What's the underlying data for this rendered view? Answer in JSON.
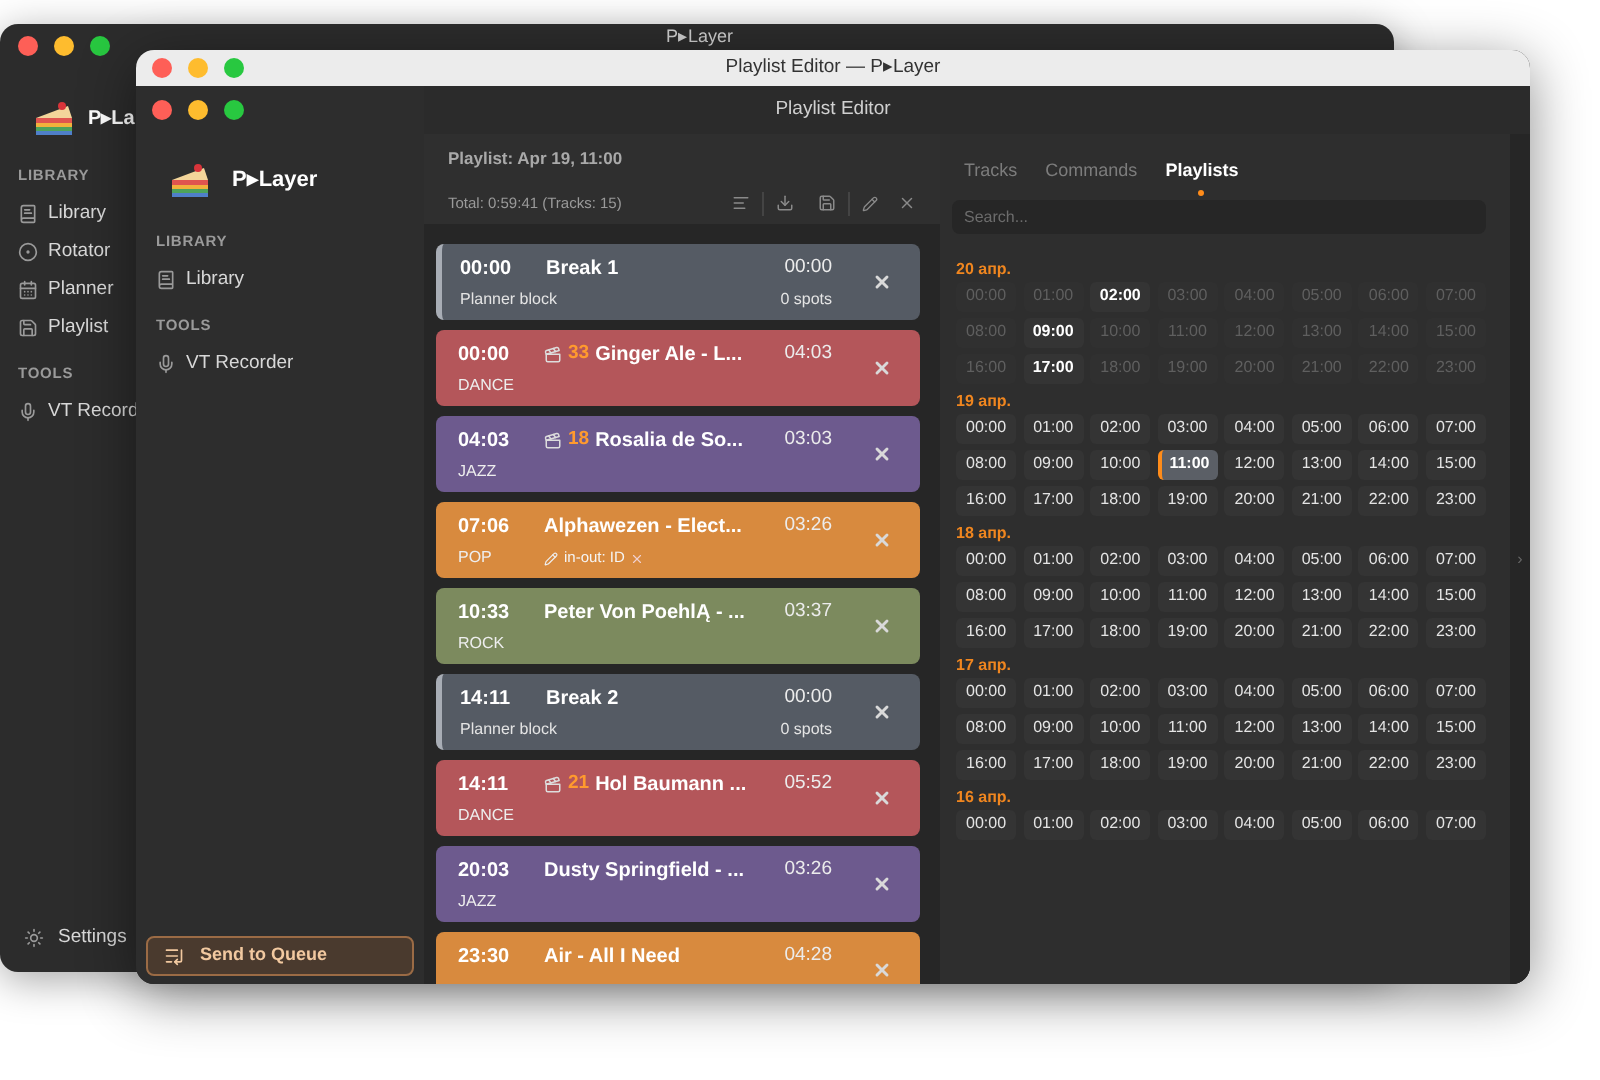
{
  "back_window": {
    "title": "P▸Layer",
    "app_name": "P▸La",
    "sections": [
      {
        "heading": "LIBRARY",
        "items": [
          {
            "label": "Library"
          },
          {
            "label": "Rotator"
          },
          {
            "label": "Planner"
          },
          {
            "label": "Playlist"
          }
        ]
      },
      {
        "heading": "TOOLS",
        "items": [
          {
            "label": "VT Record"
          }
        ]
      }
    ],
    "settings": "Settings"
  },
  "window": {
    "title": "Playlist Editor — P▸Layer",
    "inner_title": "Playlist Editor",
    "app_name": "P▸Layer",
    "sections": [
      {
        "heading": "LIBRARY",
        "items": [
          {
            "label": "Library"
          }
        ]
      },
      {
        "heading": "TOOLS",
        "items": [
          {
            "label": "VT Recorder"
          }
        ]
      }
    ],
    "send_button": "Send to Queue"
  },
  "playlist": {
    "title": "Playlist: Apr 19, 11:00",
    "total": "Total: 0:59:41 (Tracks: 15)",
    "items": [
      {
        "kind": "break",
        "start": "00:00",
        "title": "Break 1",
        "duration": "00:00",
        "subtitle": "Planner block",
        "spots": "0 spots",
        "color": "#555b64"
      },
      {
        "kind": "track",
        "start": "00:00",
        "badge": "33",
        "title": "Ginger Ale - L...",
        "duration": "04:03",
        "genre": "DANCE",
        "color": "#b4565a"
      },
      {
        "kind": "track",
        "start": "04:03",
        "badge": "18",
        "title": "Rosalia de So...",
        "duration": "03:03",
        "genre": "JAZZ",
        "color": "#6d5a8e"
      },
      {
        "kind": "track",
        "start": "07:06",
        "title": "Alphawezen - Elect...",
        "duration": "03:26",
        "genre": "POP",
        "note": "in-out: ID",
        "color": "#d88a3e"
      },
      {
        "kind": "track",
        "start": "10:33",
        "title": "Peter Von PoehlĄ - ...",
        "duration": "03:37",
        "genre": "ROCK",
        "color": "#7c8a5e"
      },
      {
        "kind": "break",
        "start": "14:11",
        "title": "Break 2",
        "duration": "00:00",
        "subtitle": "Planner block",
        "spots": "0 spots",
        "color": "#555b64"
      },
      {
        "kind": "track",
        "start": "14:11",
        "badge": "21",
        "title": "Hol Baumann ...",
        "duration": "05:52",
        "genre": "DANCE",
        "color": "#b4565a"
      },
      {
        "kind": "track",
        "start": "20:03",
        "title": "Dusty Springfield - ...",
        "duration": "03:26",
        "genre": "JAZZ",
        "color": "#6d5a8e"
      },
      {
        "kind": "track",
        "start": "23:30",
        "title": "Air - All I Need",
        "duration": "04:28",
        "color": "#d88a3e"
      }
    ]
  },
  "library": {
    "tabs": [
      {
        "label": "Tracks",
        "selected": false
      },
      {
        "label": "Commands",
        "selected": false
      },
      {
        "label": "Playlists",
        "selected": true
      }
    ],
    "search": {
      "placeholder": "Search..."
    },
    "days": [
      {
        "label": "20 апр.",
        "hours": [
          {
            "label": "00:00",
            "available": false,
            "selected": false
          },
          {
            "label": "01:00",
            "available": false,
            "selected": false
          },
          {
            "label": "02:00",
            "available": true,
            "selected": false
          },
          {
            "label": "03:00",
            "available": false,
            "selected": false
          },
          {
            "label": "04:00",
            "available": false,
            "selected": false
          },
          {
            "label": "05:00",
            "available": false,
            "selected": false
          },
          {
            "label": "06:00",
            "available": false,
            "selected": false
          },
          {
            "label": "07:00",
            "available": false,
            "selected": false
          },
          {
            "label": "08:00",
            "available": false,
            "selected": false
          },
          {
            "label": "09:00",
            "available": true,
            "selected": false
          },
          {
            "label": "10:00",
            "available": false,
            "selected": false
          },
          {
            "label": "11:00",
            "available": false,
            "selected": false
          },
          {
            "label": "12:00",
            "available": false,
            "selected": false
          },
          {
            "label": "13:00",
            "available": false,
            "selected": false
          },
          {
            "label": "14:00",
            "available": false,
            "selected": false
          },
          {
            "label": "15:00",
            "available": false,
            "selected": false
          },
          {
            "label": "16:00",
            "available": false,
            "selected": false
          },
          {
            "label": "17:00",
            "available": true,
            "selected": false
          },
          {
            "label": "18:00",
            "available": false,
            "selected": false
          },
          {
            "label": "19:00",
            "available": false,
            "selected": false
          },
          {
            "label": "20:00",
            "available": false,
            "selected": false
          },
          {
            "label": "21:00",
            "available": false,
            "selected": false
          },
          {
            "label": "22:00",
            "available": false,
            "selected": false
          },
          {
            "label": "23:00",
            "available": false,
            "selected": false
          }
        ]
      },
      {
        "label": "19 апр.",
        "hours": [
          {
            "label": "00:00",
            "available": true,
            "selected": false
          },
          {
            "label": "01:00",
            "available": true,
            "selected": false
          },
          {
            "label": "02:00",
            "available": true,
            "selected": false
          },
          {
            "label": "03:00",
            "available": true,
            "selected": false
          },
          {
            "label": "04:00",
            "available": true,
            "selected": false
          },
          {
            "label": "05:00",
            "available": true,
            "selected": false
          },
          {
            "label": "06:00",
            "available": true,
            "selected": false
          },
          {
            "label": "07:00",
            "available": true,
            "selected": false
          },
          {
            "label": "08:00",
            "available": true,
            "selected": false
          },
          {
            "label": "09:00",
            "available": true,
            "selected": false
          },
          {
            "label": "10:00",
            "available": true,
            "selected": false
          },
          {
            "label": "11:00",
            "available": true,
            "selected": true
          },
          {
            "label": "12:00",
            "available": true,
            "selected": false
          },
          {
            "label": "13:00",
            "available": true,
            "selected": false
          },
          {
            "label": "14:00",
            "available": true,
            "selected": false
          },
          {
            "label": "15:00",
            "available": true,
            "selected": false
          },
          {
            "label": "16:00",
            "available": true,
            "selected": false
          },
          {
            "label": "17:00",
            "available": true,
            "selected": false
          },
          {
            "label": "18:00",
            "available": true,
            "selected": false
          },
          {
            "label": "19:00",
            "available": true,
            "selected": false
          },
          {
            "label": "20:00",
            "available": true,
            "selected": false
          },
          {
            "label": "21:00",
            "available": true,
            "selected": false
          },
          {
            "label": "22:00",
            "available": true,
            "selected": false
          },
          {
            "label": "23:00",
            "available": true,
            "selected": false
          }
        ]
      },
      {
        "label": "18 апр.",
        "hours": [
          {
            "label": "00:00",
            "available": true,
            "selected": false
          },
          {
            "label": "01:00",
            "available": true,
            "selected": false
          },
          {
            "label": "02:00",
            "available": true,
            "selected": false
          },
          {
            "label": "03:00",
            "available": true,
            "selected": false
          },
          {
            "label": "04:00",
            "available": true,
            "selected": false
          },
          {
            "label": "05:00",
            "available": true,
            "selected": false
          },
          {
            "label": "06:00",
            "available": true,
            "selected": false
          },
          {
            "label": "07:00",
            "available": true,
            "selected": false
          },
          {
            "label": "08:00",
            "available": true,
            "selected": false
          },
          {
            "label": "09:00",
            "available": true,
            "selected": false
          },
          {
            "label": "10:00",
            "available": true,
            "selected": false
          },
          {
            "label": "11:00",
            "available": true,
            "selected": false
          },
          {
            "label": "12:00",
            "available": true,
            "selected": false
          },
          {
            "label": "13:00",
            "available": true,
            "selected": false
          },
          {
            "label": "14:00",
            "available": true,
            "selected": false
          },
          {
            "label": "15:00",
            "available": true,
            "selected": false
          },
          {
            "label": "16:00",
            "available": true,
            "selected": false
          },
          {
            "label": "17:00",
            "available": true,
            "selected": false
          },
          {
            "label": "18:00",
            "available": true,
            "selected": false
          },
          {
            "label": "19:00",
            "available": true,
            "selected": false
          },
          {
            "label": "20:00",
            "available": true,
            "selected": false
          },
          {
            "label": "21:00",
            "available": true,
            "selected": false
          },
          {
            "label": "22:00",
            "available": true,
            "selected": false
          },
          {
            "label": "23:00",
            "available": true,
            "selected": false
          }
        ]
      },
      {
        "label": "17 апр.",
        "hours": [
          {
            "label": "00:00",
            "available": true,
            "selected": false
          },
          {
            "label": "01:00",
            "available": true,
            "selected": false
          },
          {
            "label": "02:00",
            "available": true,
            "selected": false
          },
          {
            "label": "03:00",
            "available": true,
            "selected": false
          },
          {
            "label": "04:00",
            "available": true,
            "selected": false
          },
          {
            "label": "05:00",
            "available": true,
            "selected": false
          },
          {
            "label": "06:00",
            "available": true,
            "selected": false
          },
          {
            "label": "07:00",
            "available": true,
            "selected": false
          },
          {
            "label": "08:00",
            "available": true,
            "selected": false
          },
          {
            "label": "09:00",
            "available": true,
            "selected": false
          },
          {
            "label": "10:00",
            "available": true,
            "selected": false
          },
          {
            "label": "11:00",
            "available": true,
            "selected": false
          },
          {
            "label": "12:00",
            "available": true,
            "selected": false
          },
          {
            "label": "13:00",
            "available": true,
            "selected": false
          },
          {
            "label": "14:00",
            "available": true,
            "selected": false
          },
          {
            "label": "15:00",
            "available": true,
            "selected": false
          },
          {
            "label": "16:00",
            "available": true,
            "selected": false
          },
          {
            "label": "17:00",
            "available": true,
            "selected": false
          },
          {
            "label": "18:00",
            "available": true,
            "selected": false
          },
          {
            "label": "19:00",
            "available": true,
            "selected": false
          },
          {
            "label": "20:00",
            "available": true,
            "selected": false
          },
          {
            "label": "21:00",
            "available": true,
            "selected": false
          },
          {
            "label": "22:00",
            "available": true,
            "selected": false
          },
          {
            "label": "23:00",
            "available": true,
            "selected": false
          }
        ]
      },
      {
        "label": "16 апр.",
        "hours": [
          {
            "label": "00:00",
            "available": true,
            "selected": false
          },
          {
            "label": "01:00",
            "available": true,
            "selected": false
          },
          {
            "label": "02:00",
            "available": true,
            "selected": false
          },
          {
            "label": "03:00",
            "available": true,
            "selected": false
          },
          {
            "label": "04:00",
            "available": true,
            "selected": false
          },
          {
            "label": "05:00",
            "available": true,
            "selected": false
          },
          {
            "label": "06:00",
            "available": true,
            "selected": false
          },
          {
            "label": "07:00",
            "available": true,
            "selected": false
          }
        ]
      }
    ],
    "side_toggle": "›"
  }
}
